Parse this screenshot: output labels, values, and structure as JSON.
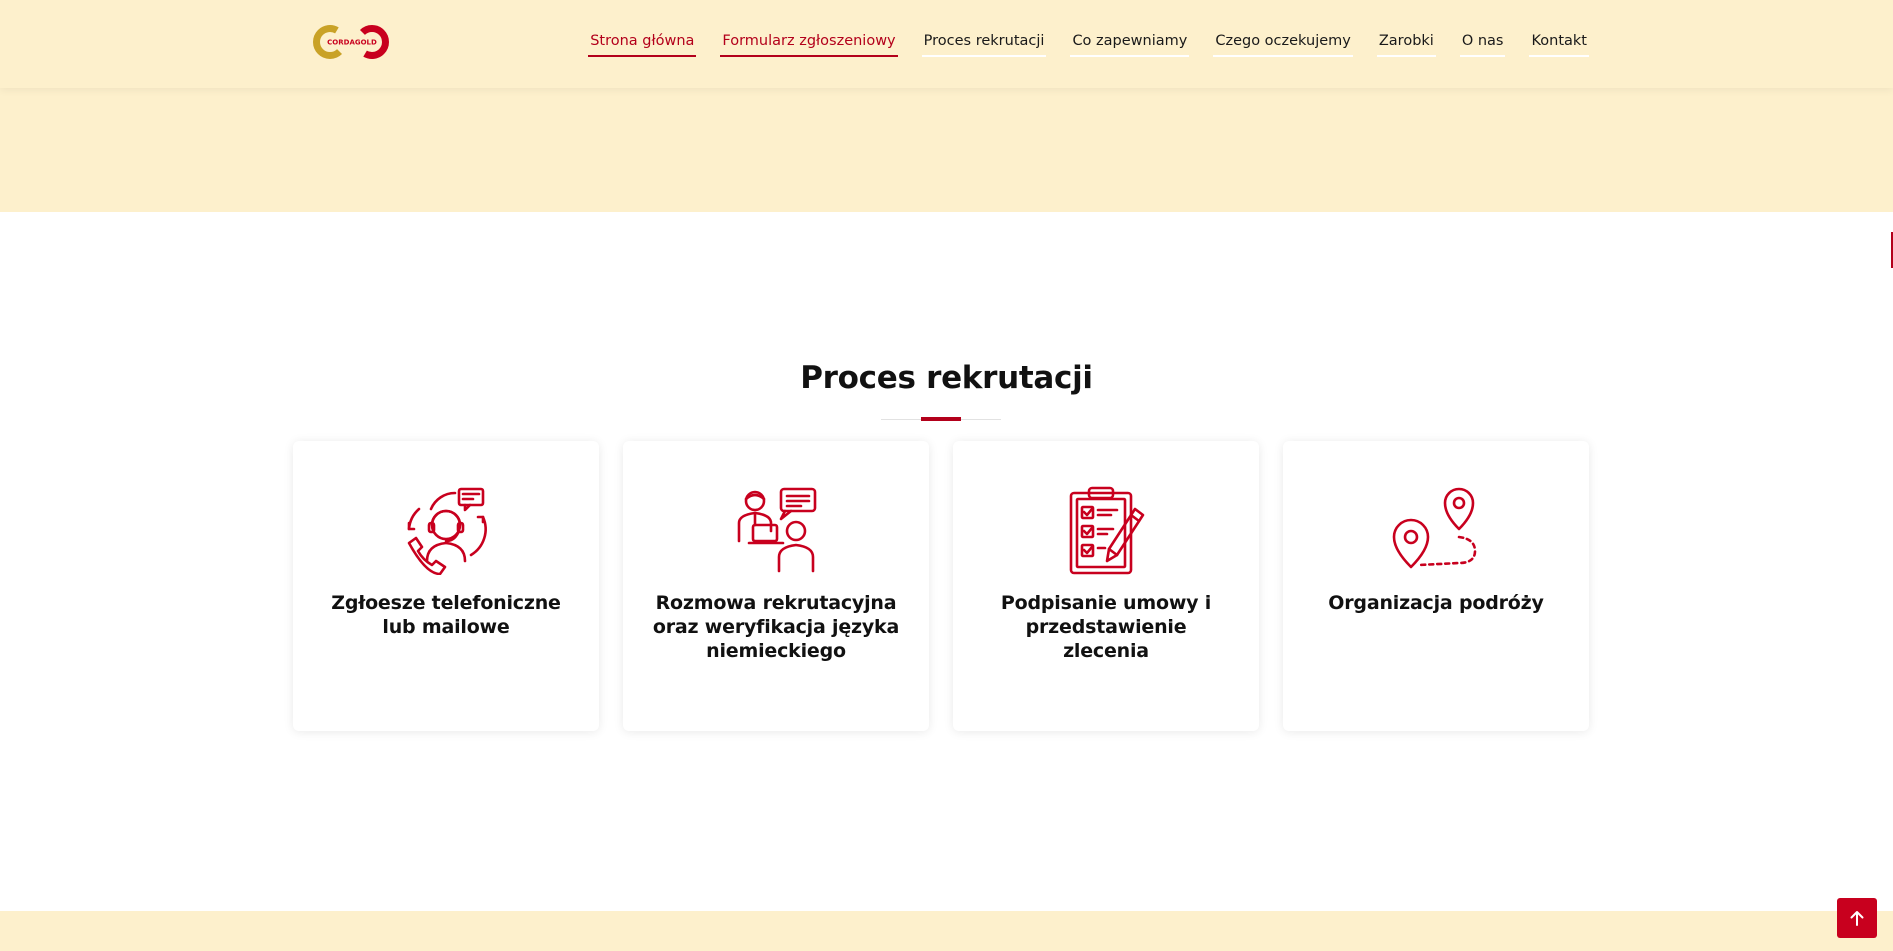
{
  "brand": {
    "logo_text": "CORDAGOLD",
    "colors": {
      "gold": "#c9a227",
      "red": "#c8001e",
      "cream": "#fdf0cc"
    }
  },
  "nav": {
    "items": [
      {
        "label": "Strona główna",
        "active": true
      },
      {
        "label": "Formularz zgłoszeniowy",
        "active": true
      },
      {
        "label": "Proces rekrutacji",
        "active": false
      },
      {
        "label": "Co zapewniamy",
        "active": false
      },
      {
        "label": "Czego oczekujemy",
        "active": false
      },
      {
        "label": "Zarobki",
        "active": false
      },
      {
        "label": "O nas",
        "active": false
      },
      {
        "label": "Kontakt",
        "active": false
      }
    ]
  },
  "section": {
    "title": "Proces rekrutacji",
    "cards": [
      {
        "icon": "call-center-icon",
        "title": "Zgłoesze telefoniczne lub mailowe"
      },
      {
        "icon": "interview-icon",
        "title": "Rozmowa rekrutacyjna oraz weryfikacja języka niemieckiego"
      },
      {
        "icon": "clipboard-checklist-icon",
        "title": "Podpisanie umowy i przedstawienie zlecenia"
      },
      {
        "icon": "map-route-icon",
        "title": "Organizacja podróży"
      }
    ]
  },
  "scroll_top": {
    "icon": "arrow-up-icon"
  }
}
